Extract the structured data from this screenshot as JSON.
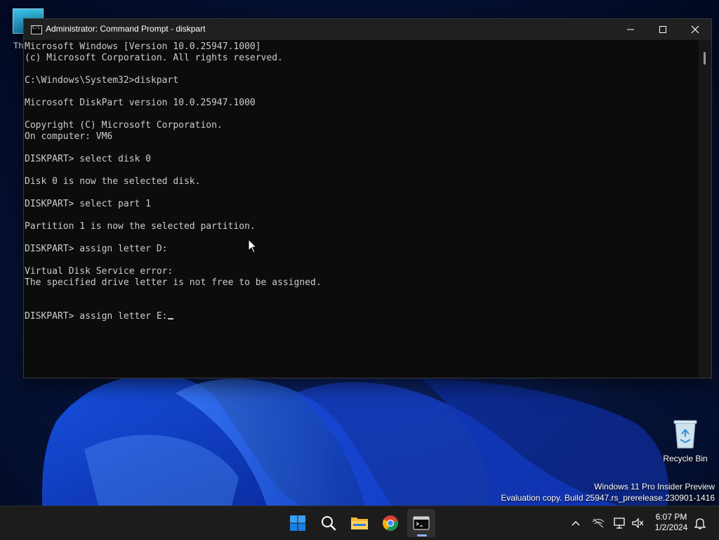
{
  "desktop": {
    "top_icon_label": "Th",
    "recycle_bin_label": "Recycle Bin",
    "watermark_line1": "Windows 11 Pro Insider Preview",
    "watermark_line2": "Evaluation copy. Build 25947.rs_prerelease.230901-1416"
  },
  "window": {
    "title": "Administrator: Command Prompt - diskpart",
    "icons": {
      "app": "cmd-icon",
      "minimize": "minimize-icon",
      "maximize": "maximize-icon",
      "close": "close-icon"
    }
  },
  "console": {
    "lines": [
      "Microsoft Windows [Version 10.0.25947.1000]",
      "(c) Microsoft Corporation. All rights reserved.",
      "",
      "C:\\Windows\\System32>diskpart",
      "",
      "Microsoft DiskPart version 10.0.25947.1000",
      "",
      "Copyright (C) Microsoft Corporation.",
      "On computer: VM6",
      "",
      "DISKPART> select disk 0",
      "",
      "Disk 0 is now the selected disk.",
      "",
      "DISKPART> select part 1",
      "",
      "Partition 1 is now the selected partition.",
      "",
      "DISKPART> assign letter D:",
      "",
      "Virtual Disk Service error:",
      "The specified drive letter is not free to be assigned.",
      "",
      "",
      "DISKPART> assign letter E:"
    ]
  },
  "taskbar": {
    "apps": [
      {
        "name": "start",
        "icon": "windows-logo-icon"
      },
      {
        "name": "search",
        "icon": "search-icon"
      },
      {
        "name": "file-explorer",
        "icon": "folder-icon"
      },
      {
        "name": "chrome",
        "icon": "chrome-icon"
      },
      {
        "name": "terminal",
        "icon": "terminal-icon",
        "active": true
      }
    ],
    "tray_icons": [
      "chevron-up-icon",
      "network-icon",
      "display-network-icon",
      "volume-muted-icon",
      "notification-bell-icon"
    ],
    "clock": {
      "time": "6:07 PM",
      "date": "1/2/2024"
    }
  },
  "colors": {
    "console_bg": "#0c0c0c",
    "console_fg": "#cccccc",
    "titlebar_bg": "#202020",
    "taskbar_bg": "#1c1c1c",
    "accent": "#0078d4"
  }
}
